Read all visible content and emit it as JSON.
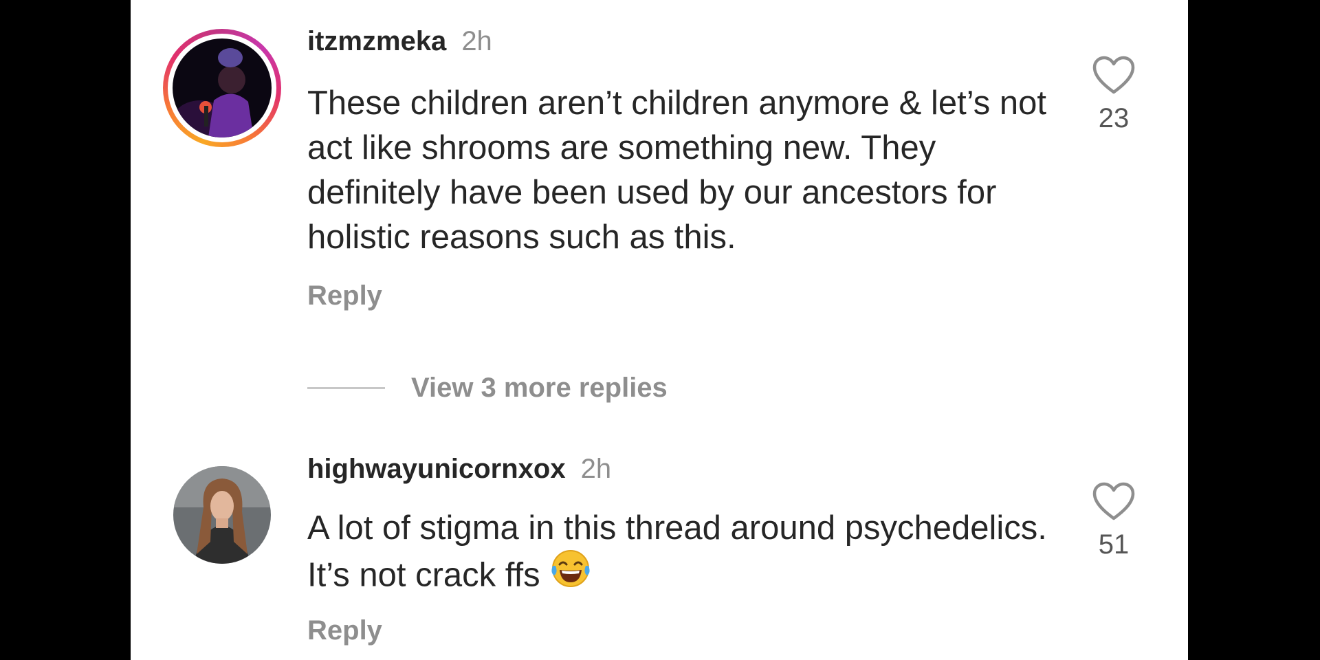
{
  "comments": [
    {
      "username": "itzmzmeka",
      "time": "2h",
      "text": "These children aren’t children anymore & let’s not act like shrooms are something new. They definitely have been used by our ancestors for holistic reasons such as this.",
      "reply_label": "Reply",
      "likes": "23",
      "has_story_ring": true
    },
    {
      "username": "highwayunicornxox",
      "time": "2h",
      "text": "A lot of stigma in this thread around psychedelics. It’s not crack ffs",
      "emoji": "face-with-tears-of-joy",
      "reply_label": "Reply",
      "likes": "51",
      "has_story_ring": false
    }
  ],
  "view_more_replies": "View 3 more replies",
  "colors": {
    "text": "#262626",
    "secondary": "#8e8e8e",
    "background": "#ffffff",
    "frame": "#000000"
  }
}
